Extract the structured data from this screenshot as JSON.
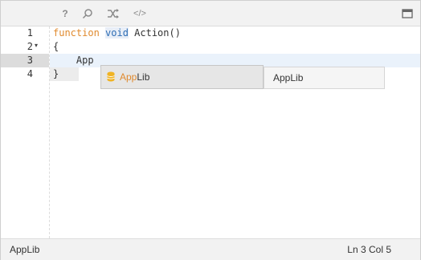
{
  "toolbar": {
    "buttons": [
      {
        "name": "help",
        "glyph": "?"
      },
      {
        "name": "search",
        "glyph": "⚲"
      },
      {
        "name": "shuffle",
        "glyph": "⤨"
      },
      {
        "name": "code",
        "glyph": "</>"
      }
    ],
    "window_glyph": "▭"
  },
  "editor": {
    "line_numbers": [
      "1",
      "2",
      "3",
      "4"
    ],
    "fold_marker": "▾",
    "lines": {
      "l1_kw1": "function",
      "l1_kw2": "void",
      "l1_rest": " Action()",
      "l2": "{",
      "l3": "    App",
      "l4": "}"
    }
  },
  "autocomplete": {
    "match": "App",
    "rest": "Lib",
    "doc": "AppLib"
  },
  "statusbar": {
    "left": "AppLib",
    "right": "Ln 3 Col 5"
  },
  "colors": {
    "keyword": "#e08a2e",
    "type_keyword": "#2f6eb5",
    "icon": "#f0b323"
  }
}
